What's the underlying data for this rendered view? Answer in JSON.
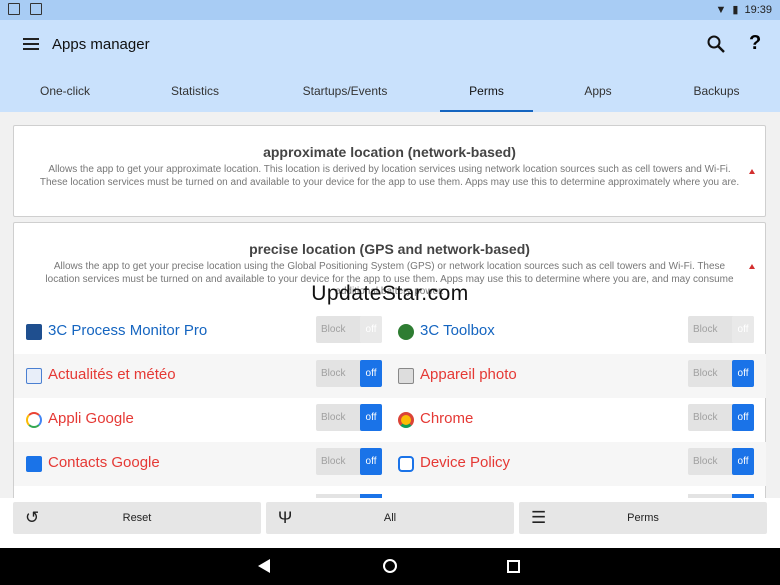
{
  "status": {
    "time": "19:39"
  },
  "header": {
    "title": "Apps manager"
  },
  "tabs": [
    {
      "label": "One-click"
    },
    {
      "label": "Statistics"
    },
    {
      "label": "Startups/Events"
    },
    {
      "label": "Perms"
    },
    {
      "label": "Apps"
    },
    {
      "label": "Backups"
    }
  ],
  "perm1": {
    "title": "approximate location (network-based)",
    "desc": "Allows the app to get your approximate location. This location is derived by location services using network location sources such as cell towers and Wi-Fi. These location services must be turned on and available to your device for the app to use them. Apps may use this to determine approximately where you are."
  },
  "perm2": {
    "title": "precise location (GPS and network-based)",
    "desc": "Allows the app to get your precise location using the Global Positioning System (GPS) or network location sources such as cell towers and Wi-Fi. These location services must be turned on and available to your device for the app to use them. Apps may use this to determine where you are, and may consume additional battery power."
  },
  "watermark": "UpdateStar.com",
  "toggle": {
    "block": "Block",
    "off": "off"
  },
  "apps": [
    {
      "name": "3C Process Monitor Pro",
      "color": "#1565c0",
      "icon": "monitor-icon",
      "state": "disabled"
    },
    {
      "name": "3C Toolbox",
      "color": "#1565c0",
      "icon": "toolbox-icon",
      "state": "disabled"
    },
    {
      "name": "Actualités et météo",
      "color": "#e53935",
      "icon": "news-icon",
      "state": "off"
    },
    {
      "name": "Appareil photo",
      "color": "#e53935",
      "icon": "camera-icon",
      "state": "off"
    },
    {
      "name": "Appli Google",
      "color": "#e53935",
      "icon": "google-icon",
      "state": "off"
    },
    {
      "name": "Chrome",
      "color": "#e53935",
      "icon": "chrome-icon",
      "state": "off"
    },
    {
      "name": "Contacts Google",
      "color": "#e53935",
      "icon": "contacts-icon",
      "state": "off"
    },
    {
      "name": "Device Policy",
      "color": "#e53935",
      "icon": "device-policy-icon",
      "state": "off"
    }
  ],
  "bottom": {
    "reset": "Reset",
    "all": "All",
    "perms": "Perms"
  }
}
